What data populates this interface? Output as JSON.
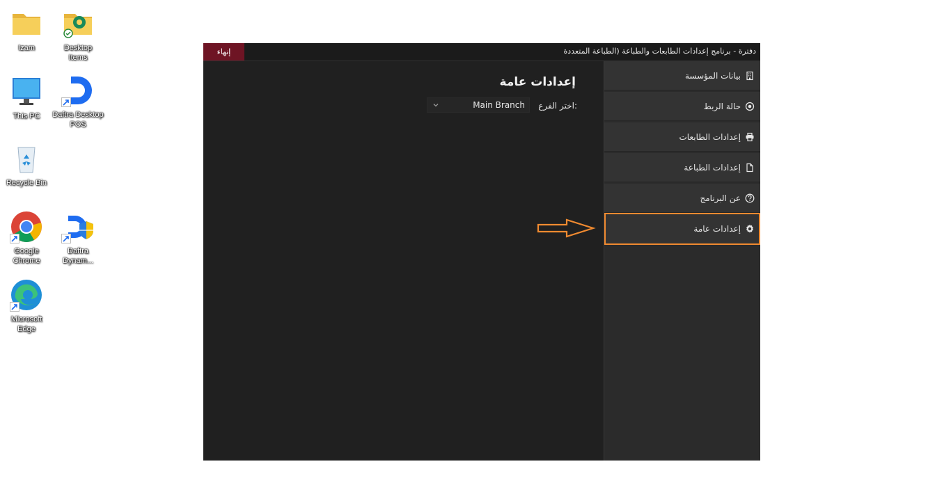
{
  "desktop": {
    "icons": [
      {
        "label": "Izam",
        "icon": "folder-icon"
      },
      {
        "label": "Desktop Items",
        "icon": "folder-edge-icon"
      },
      {
        "label": "This PC",
        "icon": "monitor-icon"
      },
      {
        "label": "Daftra Desktop POS",
        "icon": "daftra-icon"
      },
      {
        "label": "Recycle Bin",
        "icon": "recycle-bin-icon"
      },
      {
        "label": "Google Chrome",
        "icon": "chrome-icon"
      },
      {
        "label": "Daftra Dynam...",
        "icon": "daftra-dynamic-icon"
      },
      {
        "label": "Microsoft Edge",
        "icon": "edge-icon"
      }
    ]
  },
  "window": {
    "title": "دفترة - برنامج إعدادات الطابعات والطباعة (الطباعة المتعددة",
    "exit_label": "إنهاء"
  },
  "sidebar": {
    "items": [
      {
        "label": "بيانات المؤسسة",
        "icon": "building-icon"
      },
      {
        "label": "حالة الربط",
        "icon": "dot-circle-icon"
      },
      {
        "label": "إعدادات الطابعات",
        "icon": "printer-icon"
      },
      {
        "label": "إعدادات الطباعة",
        "icon": "file-icon"
      },
      {
        "label": "عن البرنامج",
        "icon": "question-circle-icon"
      },
      {
        "label": "إعدادات عامة",
        "icon": "gear-icon",
        "active": true
      }
    ]
  },
  "main": {
    "title": "إعدادات عامة",
    "branch_label": "اختر الفرع:",
    "branch_value": "Main Branch"
  },
  "colors": {
    "accent_highlight": "#f08a30",
    "exit_button": "#6e1424",
    "window_bg": "#202020",
    "sidebar_bg": "#2b2b2b"
  }
}
